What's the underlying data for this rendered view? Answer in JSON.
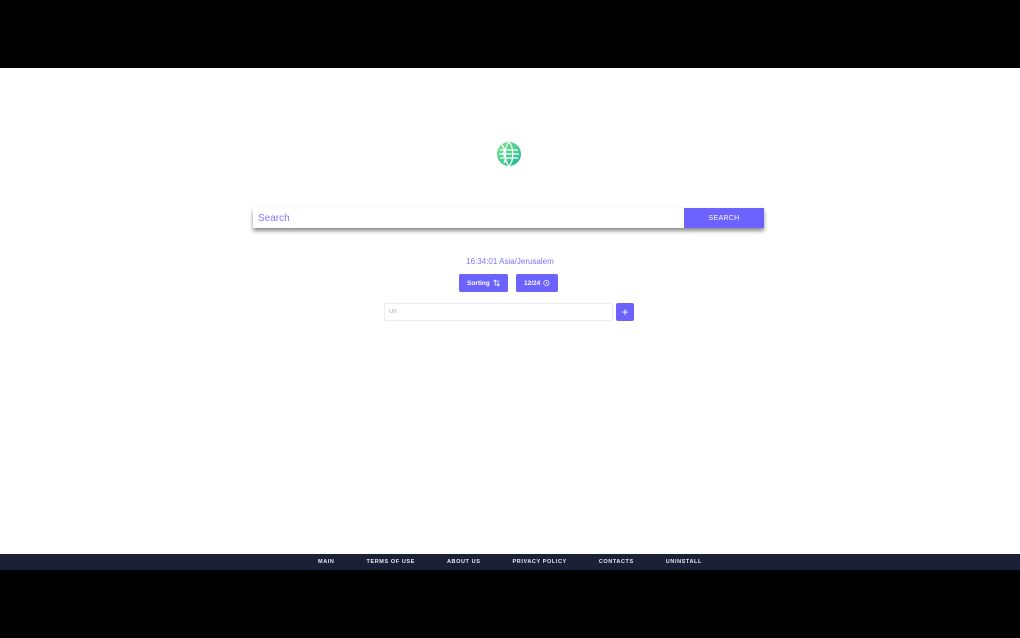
{
  "search": {
    "placeholder": "Search",
    "button_label": "SEARCH"
  },
  "clock": {
    "text": "16:34:01 Asia/Jerusalem"
  },
  "controls": {
    "sorting_label": "Sorting",
    "time_format_label": "12/24"
  },
  "add_form": {
    "placeholder": "Url",
    "add_label": "+"
  },
  "footer": {
    "links": [
      "MAIN",
      "TERMS OF USE",
      "ABOUT US",
      "PRIVACY POLICY",
      "CONTACTS",
      "UNINSTALL"
    ]
  },
  "colors": {
    "accent": "#6c63ff",
    "footer_bg": "#1c2036",
    "logo_green": "#2ecc8f"
  },
  "icons": {
    "logo": "globe-icon",
    "sorting": "sort-arrows-icon",
    "time_format": "clock-icon"
  }
}
